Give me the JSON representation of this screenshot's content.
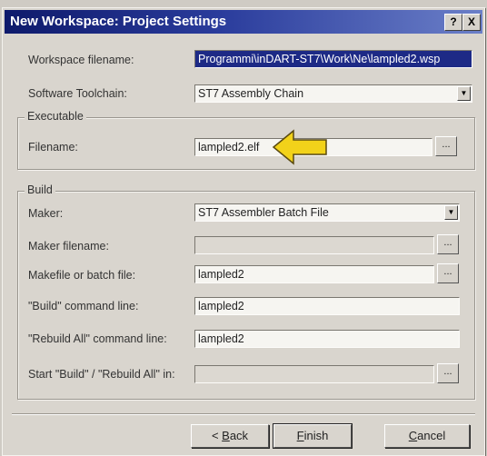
{
  "window": {
    "title": "New Workspace: Project Settings",
    "help_label": "?",
    "close_label": "X"
  },
  "fields": {
    "workspace_filename": {
      "label": "Workspace filename:",
      "value": "Programmi\\inDART-ST7\\Work\\Ne\\lampled2.wsp"
    },
    "software_toolchain": {
      "label": "Software Toolchain:",
      "value": "ST7 Assembly Chain"
    }
  },
  "executable": {
    "title": "Executable",
    "filename": {
      "label": "Filename:",
      "value": "lampled2.elf"
    },
    "browse_label": "..."
  },
  "build": {
    "title": "Build",
    "maker": {
      "label": "Maker:",
      "value": "ST7 Assembler Batch File"
    },
    "maker_filename": {
      "label": "Maker filename:",
      "value": ""
    },
    "makefile": {
      "label": "Makefile or batch file:",
      "value": "lampled2"
    },
    "build_cmd": {
      "label": "\"Build\" command line:",
      "value": "lampled2"
    },
    "rebuild_cmd": {
      "label": "\"Rebuild All\" command line:",
      "value": "lampled2"
    },
    "start_in": {
      "label": "Start \"Build\" / \"Rebuild All\" in:",
      "value": ""
    },
    "browse_label": "..."
  },
  "buttons": {
    "back": {
      "prefix": "< ",
      "accel": "B",
      "rest": "ack"
    },
    "finish": {
      "accel": "F",
      "rest": "inish"
    },
    "cancel": {
      "accel": "C",
      "rest": "ancel"
    }
  },
  "colors": {
    "title_start": "#0e1a6b",
    "title_end": "#6b7fc8",
    "arrow": "#f2d21a",
    "selection": "#1d2a86"
  },
  "icons": {
    "combo": "chevron-down-icon",
    "pointer": "yellow-arrow-icon"
  }
}
